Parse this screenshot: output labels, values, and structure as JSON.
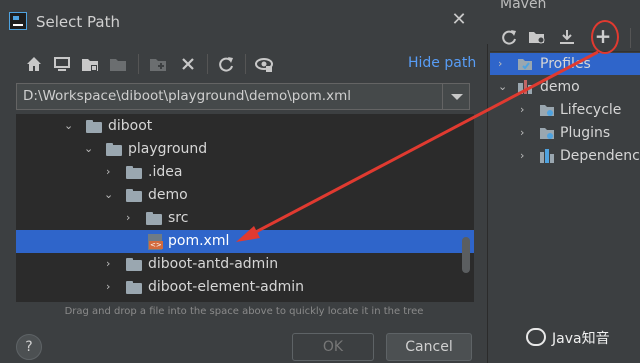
{
  "dialog": {
    "title": "Select Path",
    "hide_path_label": "Hide path",
    "path_value": "D:\\Workspace\\diboot\\playground\\demo\\pom.xml",
    "hint": "Drag and drop a file into the space above to quickly locate it in the tree",
    "ok_label": "OK",
    "cancel_label": "Cancel",
    "help_label": "?",
    "close_glyph": "✕",
    "toolbar_icons": [
      "home-icon",
      "desktop-icon",
      "project-folder-icon",
      "module-folder-icon",
      "new-folder-icon",
      "delete-icon",
      "refresh-icon",
      "show-hidden-icon"
    ]
  },
  "tree": {
    "rows": [
      {
        "label": "diboot",
        "type": "folder",
        "expanded": true,
        "depth": 0
      },
      {
        "label": "playground",
        "type": "folder",
        "expanded": true,
        "depth": 1
      },
      {
        "label": ".idea",
        "type": "folder",
        "expanded": false,
        "depth": 2
      },
      {
        "label": "demo",
        "type": "folder",
        "expanded": true,
        "depth": 2
      },
      {
        "label": "src",
        "type": "folder",
        "expanded": false,
        "depth": 3
      },
      {
        "label": "pom.xml",
        "type": "xml",
        "selected": true,
        "depth": 3
      },
      {
        "label": "diboot-antd-admin",
        "type": "folder",
        "expanded": false,
        "depth": 1
      },
      {
        "label": "diboot-element-admin",
        "type": "folder",
        "expanded": false,
        "depth": 1
      }
    ]
  },
  "maven": {
    "title": "Maven",
    "plus_label": "+",
    "items": [
      {
        "label": "Profiles",
        "expanded": false,
        "selected": true
      },
      {
        "label": "demo",
        "expanded": true
      },
      {
        "label": "Lifecycle",
        "expanded": false
      },
      {
        "label": "Plugins",
        "expanded": false
      },
      {
        "label": "Dependencies",
        "expanded": false
      }
    ]
  },
  "watermark": {
    "text": "Java知音"
  },
  "colors": {
    "selection": "#2f65ca",
    "link": "#589df6",
    "annotation_red": "#e03a30"
  }
}
